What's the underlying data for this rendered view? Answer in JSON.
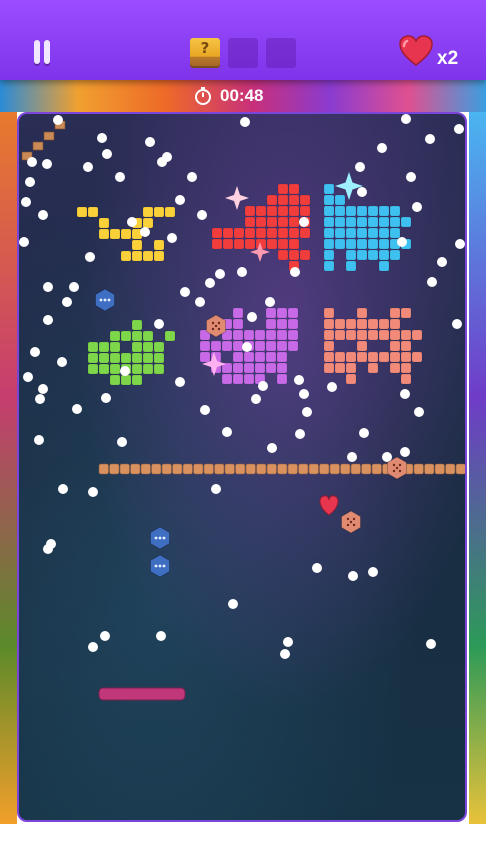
{
  "hud": {
    "lives_label": "x2",
    "timer": "00:48",
    "powerup_slots": [
      {
        "state": "filled",
        "symbol": "?"
      },
      {
        "state": "empty",
        "symbol": ""
      },
      {
        "state": "empty",
        "symbol": ""
      }
    ],
    "icons": {
      "pause": "pause-icon",
      "heart": "heart-icon",
      "timer": "stopwatch-icon"
    }
  },
  "colors": {
    "topbar": "#8b41f5",
    "yellow_block": "#fbd13a",
    "red_block": "#f23d3d",
    "blue_block": "#3ec1f0",
    "green_block": "#7ed64a",
    "purple_block": "#c86ae8",
    "salmon_block": "#f28a7a",
    "barrier": "#d9925f",
    "paddle": "#c0387a",
    "ball": "#ffffff"
  },
  "game": {
    "paddle_label": "paddle",
    "ball_count_visible": 92,
    "powerups": [
      {
        "type": "multi-ball",
        "icon": "hex-dots-icon"
      },
      {
        "type": "multi-ball",
        "icon": "hex-dots-icon"
      },
      {
        "type": "multi-ball",
        "icon": "hex-dots-icon"
      },
      {
        "type": "dice",
        "icon": "dice-hex-icon"
      },
      {
        "type": "dice",
        "icon": "dice-hex-icon"
      },
      {
        "type": "dice",
        "icon": "dice-hex-icon"
      },
      {
        "type": "extra-life",
        "icon": "heart-icon"
      }
    ]
  }
}
